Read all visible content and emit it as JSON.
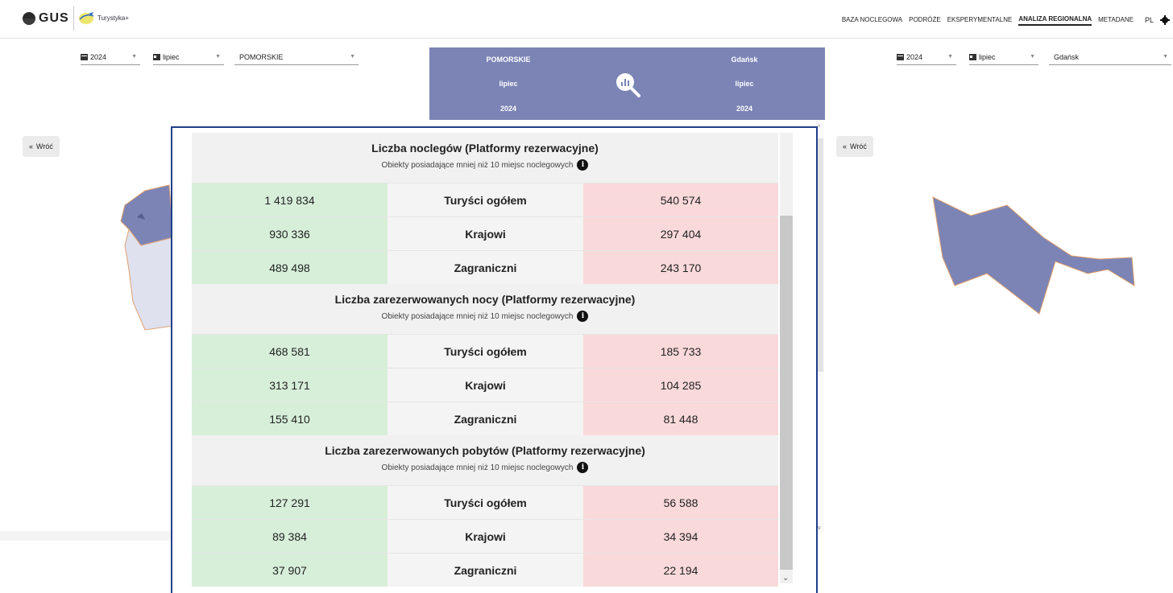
{
  "header": {
    "logo_text": "GUS",
    "app_name": "Turystyka+",
    "nav": [
      "BAZA NOCLEGOWA",
      "PODRÓŻE",
      "EKSPERYMENTALNE",
      "ANALIZA REGIONALNA",
      "METADANE"
    ],
    "active_nav": "ANALIZA REGIONALNA",
    "lang": "PL"
  },
  "left_filters": {
    "year": "2024",
    "month": "lipiec",
    "region": "POMORSKIE"
  },
  "right_filters": {
    "year": "2024",
    "month": "lipiec",
    "region": "Gdańsk"
  },
  "summary": {
    "left": {
      "region": "POMORSKIE",
      "month": "lipiec",
      "year": "2024"
    },
    "right": {
      "region": "Gdańsk",
      "month": "lipiec",
      "year": "2024"
    }
  },
  "back_label": "Wróć",
  "colors": {
    "summary_bg": "#7b84b5",
    "map_fill": "#7b84b5",
    "left_col": "#d7efd9",
    "right_col": "#f9d9da"
  },
  "sections": [
    {
      "title": "Liczba noclegów (Platformy rezerwacyjne)",
      "subtitle": "Obiekty posiadające mniej niż 10 miejsc noclegowych",
      "rows": [
        {
          "left": "1 419 834",
          "label": "Turyści ogółem",
          "right": "540 574"
        },
        {
          "left": "930 336",
          "label": "Krajowi",
          "right": "297 404"
        },
        {
          "left": "489 498",
          "label": "Zagraniczni",
          "right": "243 170"
        }
      ]
    },
    {
      "title": "Liczba zarezerwowanych nocy (Platformy rezerwacyjne)",
      "subtitle": "Obiekty posiadające mniej niż 10 miejsc noclegowych",
      "rows": [
        {
          "left": "468 581",
          "label": "Turyści ogółem",
          "right": "185 733"
        },
        {
          "left": "313 171",
          "label": "Krajowi",
          "right": "104 285"
        },
        {
          "left": "155 410",
          "label": "Zagraniczni",
          "right": "81 448"
        }
      ]
    },
    {
      "title": "Liczba zarezerwowanych pobytów (Platformy rezerwacyjne)",
      "subtitle": "Obiekty posiadające mniej niż 10 miejsc noclegowych",
      "rows": [
        {
          "left": "127 291",
          "label": "Turyści ogółem",
          "right": "56 588"
        },
        {
          "left": "89 384",
          "label": "Krajowi",
          "right": "34 394"
        },
        {
          "left": "37 907",
          "label": "Zagraniczni",
          "right": "22 194"
        }
      ]
    }
  ]
}
